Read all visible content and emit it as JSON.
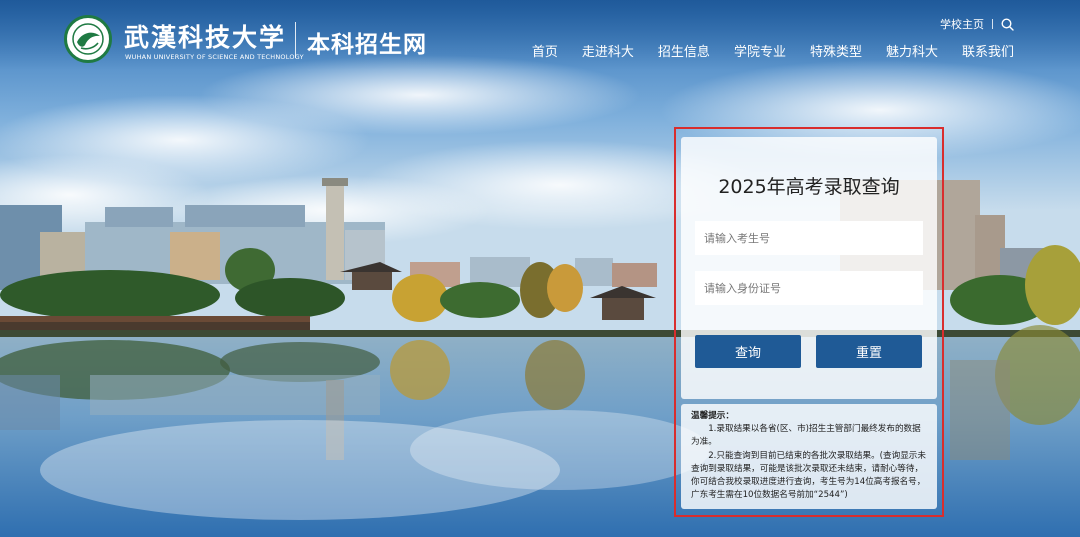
{
  "header": {
    "logo_cn": "武漢科技大学",
    "logo_en": "WUHAN UNIVERSITY OF SCIENCE AND TECHNOLOGY",
    "site_title": "本科招生网",
    "top_link": "学校主页",
    "search_icon": "search-icon",
    "nav": [
      "首页",
      "走进科大",
      "招生信息",
      "学院专业",
      "特殊类型",
      "魅力科大",
      "联系我们"
    ]
  },
  "query": {
    "title": "2025年高考录取查询",
    "exam_no_placeholder": "请输入考生号",
    "id_no_placeholder": "请输入身份证号",
    "query_label": "查询",
    "reset_label": "重置"
  },
  "tips": {
    "heading": "温馨提示：",
    "items": [
      "1.录取结果以各省(区、市)招生主管部门最终发布的数据为准。",
      "2.只能查询到目前已结束的各批次录取结果。(查询显示未查询到录取结果，可能是该批次录取还未结束，请耐心等待，你可结合我校录取进度进行查询，考生号为14位高考报名号，广东考生需在10位数据名号前加“2544”)"
    ]
  },
  "colors": {
    "button": "#1f5a96",
    "highlight": "#d92d2d",
    "logo_green": "#1f7a43"
  }
}
